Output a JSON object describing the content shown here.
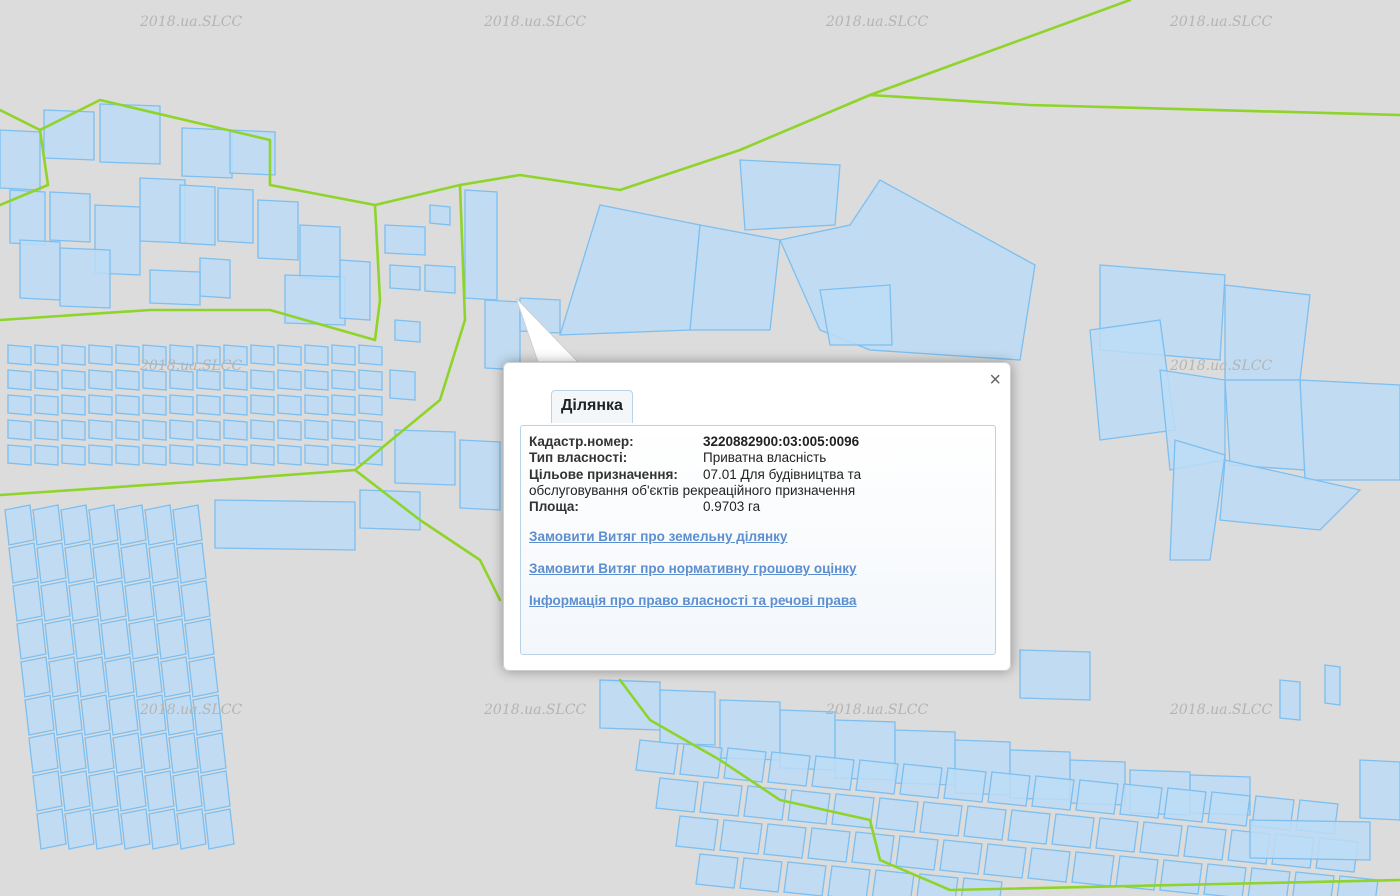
{
  "watermark_text": "2018.ua.SLCC",
  "colors": {
    "background": "#dcdcdc",
    "parcel_fill": "#bcdcf6",
    "parcel_stroke": "#7cbff0",
    "boundary": "#8fd42a",
    "link": "#5c8ed0"
  },
  "popup": {
    "close_glyph": "×",
    "tab_label": "Ділянка",
    "fields": {
      "cadastral_label": "Кадастр.номер:",
      "cadastral_value": "3220882900:03:005:0096",
      "ownership_label": "Тип власності:",
      "ownership_value": "Приватна власність",
      "purpose_label": "Цільове призначення:",
      "purpose_value": "07.01 Для будівництва та",
      "purpose_value_cont": "обслуговування об'єктів рекреаційного призначення",
      "area_label": "Площа:",
      "area_value": "0.9703 га"
    },
    "links": [
      "Замовити Витяг про земельну ділянку",
      "Замовити Витяг про нормативну грошову оцінку",
      "Інформація про право власності та речові права"
    ]
  }
}
